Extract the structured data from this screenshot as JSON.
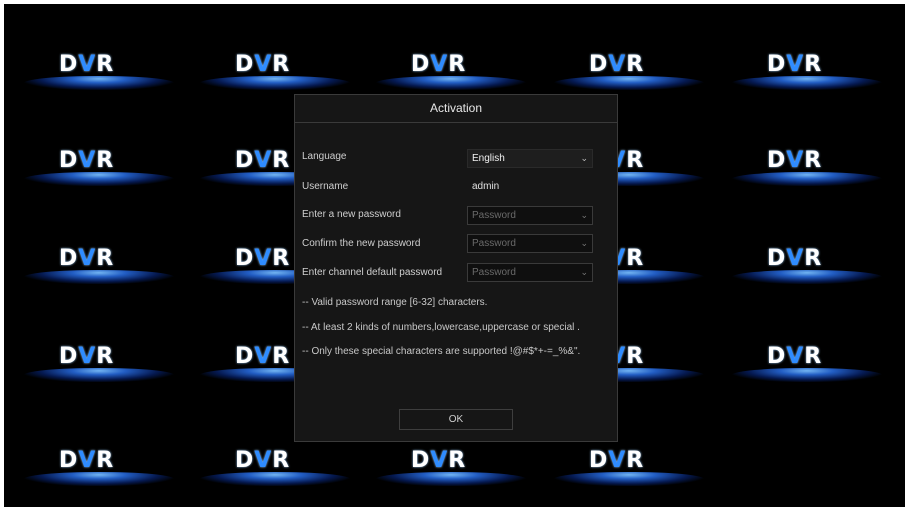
{
  "background": {
    "logo_text": "DVR",
    "logo_accent_color": "#2f8cff",
    "glow_color": "#1e5fd6"
  },
  "dialog": {
    "title": "Activation",
    "language": {
      "label": "Language",
      "value": "English"
    },
    "username": {
      "label": "Username",
      "value": "admin"
    },
    "new_password": {
      "label": "Enter a new password",
      "placeholder": "Password"
    },
    "confirm_password": {
      "label": "Confirm the new password",
      "placeholder": "Password"
    },
    "channel_password": {
      "label": "Enter channel default password",
      "placeholder": "Password"
    },
    "hints": [
      "-- Valid password range [6-32] characters.",
      "-- At least 2 kinds of numbers,lowercase,uppercase or special .",
      "-- Only these special characters are supported !@#$*+-=_%&\"."
    ],
    "ok_label": "OK"
  },
  "icons": {
    "dropdown": "chevron-down-icon"
  }
}
